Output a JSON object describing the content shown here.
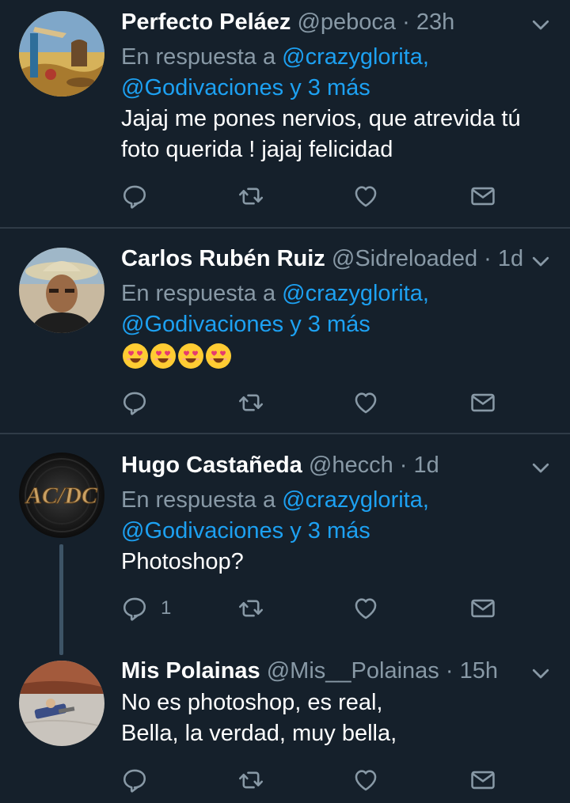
{
  "colors": {
    "background": "#15202b",
    "divider": "#2f3b47",
    "secondary_text": "#8899a6",
    "link": "#1da1f2"
  },
  "tweets": [
    {
      "name": "Perfecto Peláez",
      "handle": "@peboca",
      "separator": "·",
      "time": "23h",
      "reply_prefix": "En respuesta a",
      "mention1": "@crazyglorita,",
      "mention2": "@Godivaciones y 3 más",
      "text_line1": "Jajaj me pones nervios, que atrevida tú",
      "text_line2": "foto querida ! jajaj felicidad",
      "reply_count": "",
      "avatar_icon": "surreal-painting-avatar"
    },
    {
      "name": "Carlos Rubén Ruiz",
      "handle": "@Sidreloaded",
      "separator": "·",
      "time": "1d",
      "reply_prefix": "En respuesta a",
      "mention1": "@crazyglorita,",
      "mention2": "@Godivaciones y 3 más",
      "emoji": [
        "heart-eyes-emoji",
        "heart-eyes-emoji",
        "heart-eyes-emoji",
        "heart-eyes-emoji"
      ],
      "reply_count": "",
      "avatar_icon": "man-with-hat-avatar"
    },
    {
      "name": "Hugo Castañeda",
      "handle": "@hecch",
      "separator": "·",
      "time": "1d",
      "reply_prefix": "En respuesta a",
      "mention1": "@crazyglorita,",
      "mention2": "@Godivaciones y 3 más",
      "text_line1": "Photoshop?",
      "reply_count": "1",
      "avatar_text": "AC/DC",
      "avatar_icon": "acdc-logo-avatar"
    },
    {
      "name": "Mis Polainas",
      "handle": "@Mis__Polainas",
      "separator": "·",
      "time": "15h",
      "text_line1": "No es photoshop, es real,",
      "text_line2": "Bella, la verdad, muy bella,",
      "reply_count": "",
      "avatar_icon": "toy-on-floor-avatar"
    }
  ],
  "action_icons": [
    "reply-icon",
    "retweet-icon",
    "like-icon",
    "message-icon"
  ]
}
